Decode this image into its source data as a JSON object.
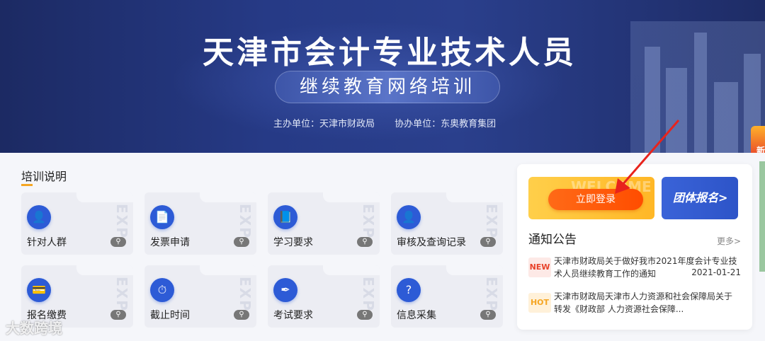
{
  "banner": {
    "title": "天津市会计专业技术人员",
    "subtitle": "继续教育网络培训",
    "host": "主办单位：天津市财政局",
    "cohost": "协办单位：东奥教育集团",
    "corner_tag": "新"
  },
  "training": {
    "title": "培训说明",
    "items": [
      {
        "label": "针对人群",
        "icon": "people-icon",
        "glyph": "👤"
      },
      {
        "label": "发票申请",
        "icon": "invoice-icon",
        "glyph": "📄"
      },
      {
        "label": "学习要求",
        "icon": "book-icon",
        "glyph": "📘"
      },
      {
        "label": "审核及查询记录",
        "icon": "user-check-icon",
        "glyph": "👤"
      },
      {
        "label": "报名缴费",
        "icon": "wallet-icon",
        "glyph": "💳"
      },
      {
        "label": "截止时间",
        "icon": "stopwatch-icon",
        "glyph": "⏱"
      },
      {
        "label": "考试要求",
        "icon": "pen-nib-icon",
        "glyph": "✒"
      },
      {
        "label": "信息采集",
        "icon": "clipboard-question-icon",
        "glyph": "?"
      }
    ]
  },
  "panel": {
    "login_label": "立即登录",
    "group_label": "团体报名>",
    "notice_title": "通知公告",
    "more_label": "更多>",
    "notices": [
      {
        "badge": "NEW",
        "text": "天津市财政局关于做好我市2021年度会计专业技术人员继续教育工作的通知",
        "date": "2021-01-21"
      },
      {
        "badge": "HOT",
        "text": "天津市财政局天津市人力资源和社会保障局关于转发《财政部 人力资源社会保障...",
        "date": ""
      }
    ]
  },
  "watermark": "大数跨境",
  "colors": {
    "accent": "#ff5a0a",
    "primary": "#2d5bd6",
    "banner": "#263a86"
  }
}
